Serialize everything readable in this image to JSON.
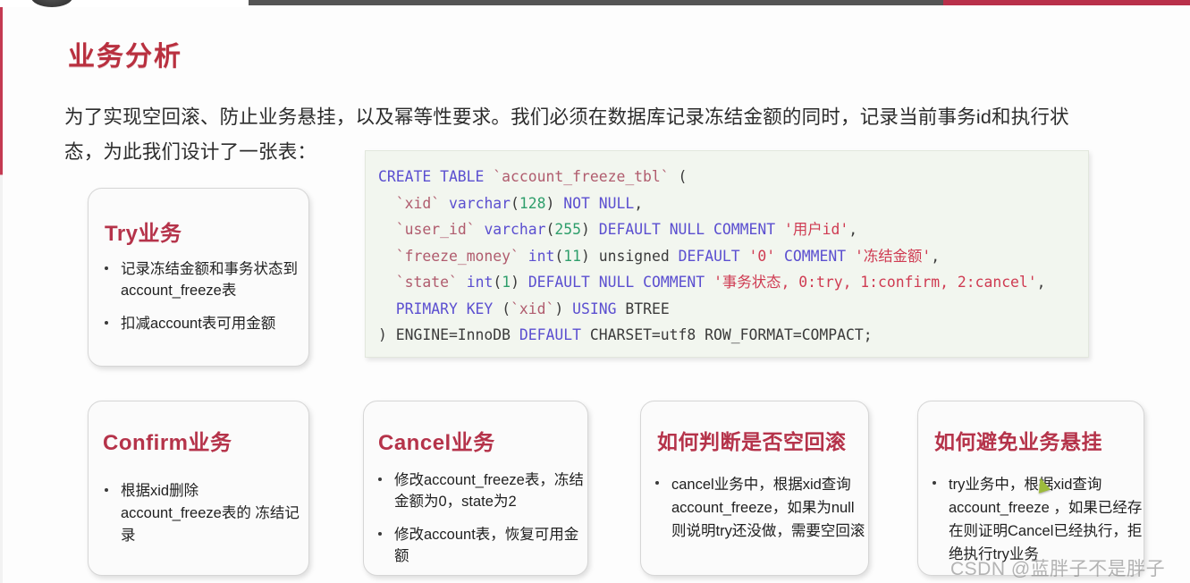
{
  "player": {
    "progress_track_color": "#555555",
    "progress_played_color": "#b9304a",
    "knob_name": "playhead-knob"
  },
  "slide": {
    "title": "业务分析",
    "title_color": "#b9303f",
    "intro_line1": "为了实现空回滚、防止业务悬挂，以及幂等性要求。我们必须在数据库记录冻结金额的同时，记录当前事务id和执行状",
    "intro_line2": "态，为此我们设计了一张表："
  },
  "code": {
    "language": "sql",
    "background": "#f2f6ef",
    "lines": [
      "CREATE TABLE `account_freeze_tbl` (",
      "  `xid` varchar(128) NOT NULL,",
      "  `user_id` varchar(255) DEFAULT NULL COMMENT '用户id',",
      "  `freeze_money` int(11) unsigned DEFAULT '0' COMMENT '冻结金额',",
      "  `state` int(1) DEFAULT NULL COMMENT '事务状态, 0:try, 1:confirm, 2:cancel',",
      "  PRIMARY KEY (`xid`) USING BTREE",
      ") ENGINE=InnoDB DEFAULT CHARSET=utf8 ROW_FORMAT=COMPACT;"
    ],
    "tokens": {
      "keyword_color": "#5b4fd0",
      "identifier_color": "#b05c6e",
      "number_color": "#2e9e6b",
      "string_color": "#cf3b52"
    }
  },
  "cards": [
    {
      "id": "try",
      "title": "Try业务",
      "bullets": [
        "记录冻结金额和事务状态到 account_freeze表",
        "扣减account表可用金额"
      ]
    },
    {
      "id": "confirm",
      "title": "Confirm业务",
      "bullets": [
        "根据xid删除 account_freeze表的 冻结记录"
      ]
    },
    {
      "id": "cancel",
      "title": "Cancel业务",
      "bullets": [
        "修改account_freeze表，冻结金额为0，state为2",
        "修改account表，恢复可用金额"
      ]
    },
    {
      "id": "rollback",
      "title": "如何判断是否空回滚",
      "bullets": [
        "cancel业务中，根据xid查询account_freeze，如果为null则说明try还没做，需要空回滚"
      ]
    },
    {
      "id": "suspend",
      "title": "如何避免业务悬挂",
      "bullets": [
        "try业务中，根据xid查询account_freeze ，如果已经存在则证明Cancel已经执行，拒绝执行try业务"
      ]
    }
  ],
  "watermark": "CSDN @蓝胖子不是胖子"
}
